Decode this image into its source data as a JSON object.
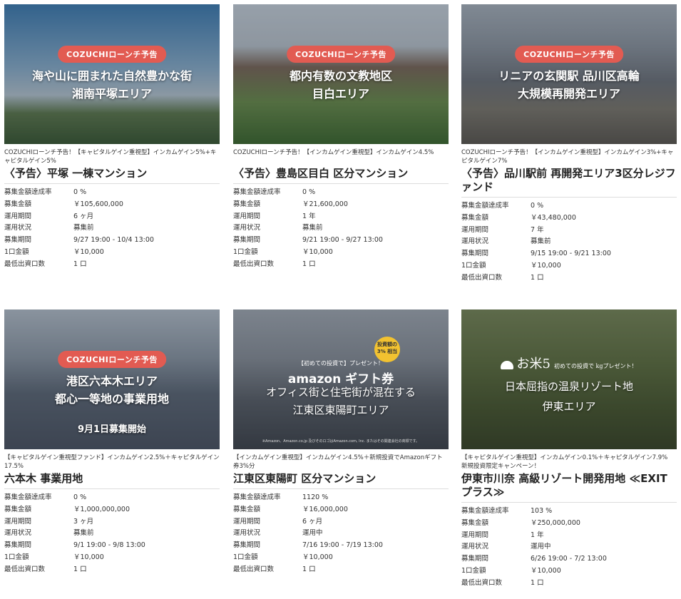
{
  "listings": [
    {
      "badge": "COZUCHIローンチ予告",
      "banner_line1": "海や山に囲まれた自然豊かな街",
      "banner_line2": "湘南平塚エリア",
      "subtitle": "COZUCHIローンチ予告！【キャピタルゲイン重視型】インカムゲイン5%+キャピタルゲイン5%",
      "name": "〈予告〉平塚 一棟マンション",
      "details": [
        {
          "label": "募集金額達成率",
          "value": "0 %"
        },
        {
          "label": "募集金額",
          "value": "￥105,600,000"
        },
        {
          "label": "運用期間",
          "value": "6 ヶ月"
        },
        {
          "label": "運用状況",
          "value": "募集前"
        },
        {
          "label": "募集期間",
          "value": "9/27 19:00 - 10/4 13:00"
        },
        {
          "label": "1口金額",
          "value": "￥10,000"
        },
        {
          "label": "最低出資口数",
          "value": "1 口"
        }
      ]
    },
    {
      "badge": "COZUCHIローンチ予告",
      "banner_line1": "都内有数の文教地区",
      "banner_line2": "目白エリア",
      "subtitle": "COZUCHIローンチ予告！【インカムゲイン重視型】インカムゲイン4.5%",
      "name": "〈予告〉豊島区目白 区分マンション",
      "details": [
        {
          "label": "募集金額達成率",
          "value": "0 %"
        },
        {
          "label": "募集金額",
          "value": "￥21,600,000"
        },
        {
          "label": "運用期間",
          "value": "1 年"
        },
        {
          "label": "運用状況",
          "value": "募集前"
        },
        {
          "label": "募集期間",
          "value": "9/21 19:00 - 9/27 13:00"
        },
        {
          "label": "1口金額",
          "value": "￥10,000"
        },
        {
          "label": "最低出資口数",
          "value": "1 口"
        }
      ]
    },
    {
      "badge": "COZUCHIローンチ予告",
      "banner_line1": "リニアの玄関駅 品川区高輪",
      "banner_line2": "大規模再開発エリア",
      "subtitle": "COZUCHIローンチ予告！【インカムゲイン重視型】インカムゲイン3%+キャピタルゲイン7%",
      "name": "〈予告〉品川駅前 再開発エリア3区分レジファンド",
      "details": [
        {
          "label": "募集金額達成率",
          "value": "0 %"
        },
        {
          "label": "募集金額",
          "value": "￥43,480,000"
        },
        {
          "label": "運用期間",
          "value": "7 年"
        },
        {
          "label": "運用状況",
          "value": "募集前"
        },
        {
          "label": "募集期間",
          "value": "9/15 19:00 - 9/21 13:00"
        },
        {
          "label": "1口金額",
          "value": "￥10,000"
        },
        {
          "label": "最低出資口数",
          "value": "1 口"
        }
      ]
    },
    {
      "badge": "COZUCHIローンチ予告",
      "banner_line1": "港区六本木エリア",
      "banner_line2": "都心一等地の事業用地",
      "banner_note": "9月1日募集開始",
      "subtitle": "【キャピタルゲイン重視型ファンド】インカムゲイン2.5%＋キャピタルゲイン17.5%",
      "name": "六本木 事業用地",
      "details": [
        {
          "label": "募集金額達成率",
          "value": "0 %"
        },
        {
          "label": "募集金額",
          "value": "￥1,000,000,000"
        },
        {
          "label": "運用期間",
          "value": "3 ヶ月"
        },
        {
          "label": "運用状況",
          "value": "募集前"
        },
        {
          "label": "募集期間",
          "value": "9/1 19:00 - 9/8 13:00"
        },
        {
          "label": "1口金額",
          "value": "￥10,000"
        },
        {
          "label": "最低出資口数",
          "value": "1 口"
        }
      ]
    },
    {
      "promo_pre": "【初めての投資で】プレゼント！",
      "promo_logo": "amazon ギフト券",
      "promo_coin": "投資額の 3% 相当",
      "banner_line1": "オフィス街と住宅街が混在する",
      "banner_line2": "江東区東陽町エリア",
      "fine_print": "※Amazon、Amazon.co.jp 及びそのロゴはAmazon.com, Inc. またはその関連会社の商標です。",
      "subtitle": "【インカムゲイン重視型】インカムゲイン4.5%＋新規投資でAmazonギフト券3%分",
      "name": "江東区東陽町 区分マンション",
      "details": [
        {
          "label": "募集金額達成率",
          "value": "1120 %"
        },
        {
          "label": "募集金額",
          "value": "￥16,000,000"
        },
        {
          "label": "運用期間",
          "value": "6 ヶ月"
        },
        {
          "label": "運用状況",
          "value": "運用中"
        },
        {
          "label": "募集期間",
          "value": "7/16 19:00 - 7/19 13:00"
        },
        {
          "label": "1口金額",
          "value": "￥10,000"
        },
        {
          "label": "最低出資口数",
          "value": "1 口"
        }
      ]
    },
    {
      "promo_main": "お米5",
      "promo_side": "初めての投資で kgプレゼント！",
      "banner_line1": "日本屈指の温泉リゾート地",
      "banner_line2": "伊東エリア",
      "subtitle": "【キャピタルゲイン重視型】インカムゲイン0.1%＋キャピタルゲイン7.9%　新規投資限定キャンペーン！",
      "name": "伊東市川奈 高級リゾート開発用地 ≪EXITプラス≫",
      "details": [
        {
          "label": "募集金額達成率",
          "value": "103 %"
        },
        {
          "label": "募集金額",
          "value": "￥250,000,000"
        },
        {
          "label": "運用期間",
          "value": "1 年"
        },
        {
          "label": "運用状況",
          "value": "運用中"
        },
        {
          "label": "募集期間",
          "value": "6/26 19:00 - 7/2 13:00"
        },
        {
          "label": "1口金額",
          "value": "￥10,000"
        },
        {
          "label": "最低出資口数",
          "value": "1 口"
        }
      ]
    }
  ]
}
